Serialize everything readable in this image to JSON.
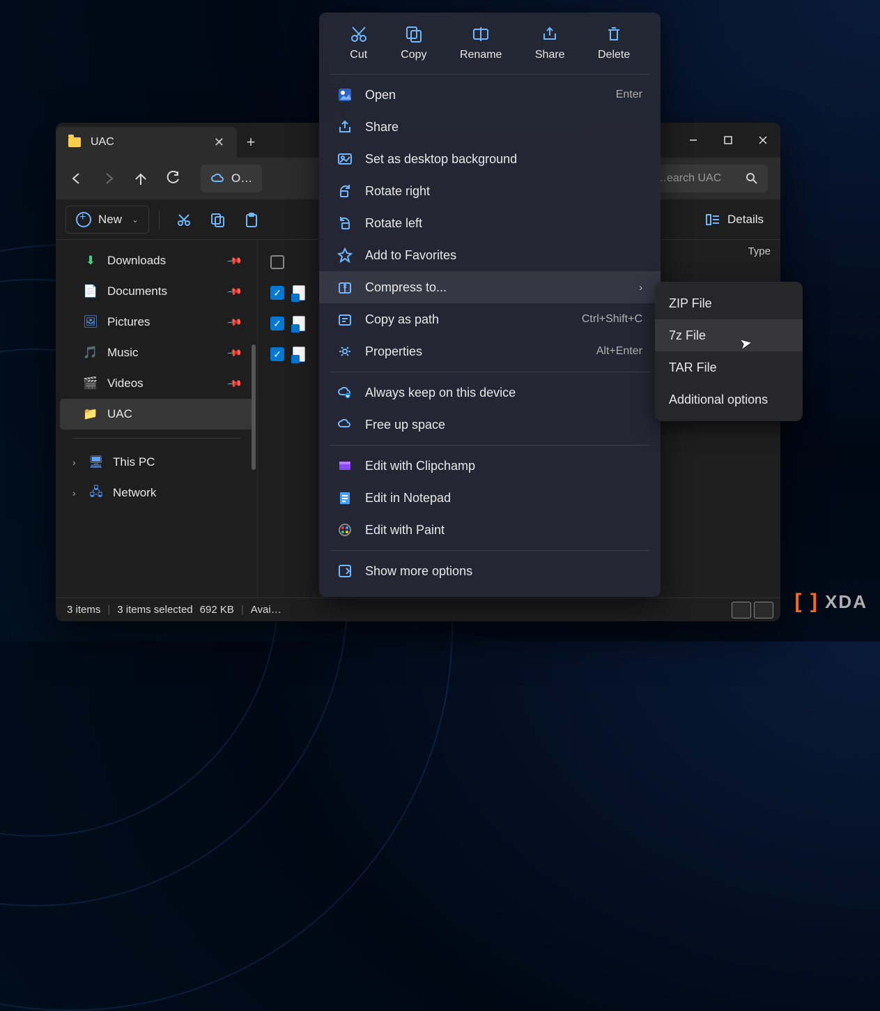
{
  "window": {
    "tab_title": "UAC",
    "new_label": "New",
    "details_label": "Details",
    "breadcrumb_segment": "O…",
    "search_placeholder": "…earch UAC",
    "col_type": "Type"
  },
  "sidebar": {
    "items": [
      {
        "label": "Downloads",
        "pinned": true,
        "icon": "download"
      },
      {
        "label": "Documents",
        "pinned": true,
        "icon": "document"
      },
      {
        "label": "Pictures",
        "pinned": true,
        "icon": "pictures"
      },
      {
        "label": "Music",
        "pinned": true,
        "icon": "music"
      },
      {
        "label": "Videos",
        "pinned": true,
        "icon": "videos"
      },
      {
        "label": "UAC",
        "pinned": false,
        "icon": "folder",
        "active": true
      }
    ],
    "root_items": [
      {
        "label": "This PC",
        "icon": "pc"
      },
      {
        "label": "Network",
        "icon": "network"
      }
    ]
  },
  "status": {
    "total": "3 items",
    "selected": "3 items selected",
    "size": "692 KB",
    "avail": "Avai…"
  },
  "toolbar_actions": {
    "cut": "Cut",
    "copy": "Copy",
    "rename": "Rename",
    "share": "Share",
    "delete": "Delete"
  },
  "ctx_actions": {
    "open": {
      "label": "Open",
      "shortcut": "Enter"
    },
    "share": {
      "label": "Share"
    },
    "desktop_bg": {
      "label": "Set as desktop background"
    },
    "rotate_right": {
      "label": "Rotate right"
    },
    "rotate_left": {
      "label": "Rotate left"
    },
    "favorites": {
      "label": "Add to Favorites"
    },
    "compress": {
      "label": "Compress to..."
    },
    "copy_path": {
      "label": "Copy as path",
      "shortcut": "Ctrl+Shift+C"
    },
    "properties": {
      "label": "Properties",
      "shortcut": "Alt+Enter"
    },
    "keep_device": {
      "label": "Always keep on this device"
    },
    "free_space": {
      "label": "Free up space"
    },
    "clipchamp": {
      "label": "Edit with Clipchamp"
    },
    "notepad": {
      "label": "Edit in Notepad"
    },
    "paint": {
      "label": "Edit with Paint"
    },
    "more": {
      "label": "Show more options"
    }
  },
  "submenu": {
    "items": [
      "ZIP File",
      "7z File",
      "TAR File",
      "Additional options"
    ]
  },
  "watermark": "XDA"
}
